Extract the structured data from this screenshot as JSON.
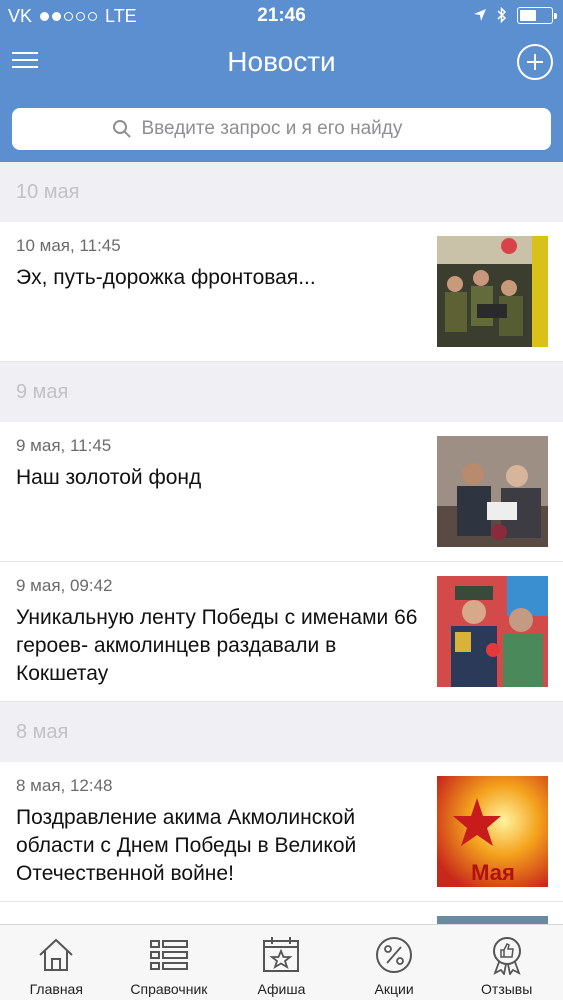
{
  "status_bar": {
    "carrier": "VK",
    "network": "LTE",
    "time": "21:46",
    "signal_bars_filled": 2,
    "signal_bars_total": 5,
    "battery_level": 0.55
  },
  "nav": {
    "title": "Новости",
    "menu_icon": "hamburger-menu-icon",
    "add_icon": "plus-circle-icon"
  },
  "search": {
    "placeholder": "Введите запрос и я его найду",
    "value": ""
  },
  "feed": {
    "date_10": "10 мая",
    "date_9": "9 мая",
    "date_8": "8 мая",
    "items": [
      {
        "time": "10 мая, 11:45",
        "title": "Эх, путь-дорожка фронтовая..."
      },
      {
        "time": "9 мая, 11:45",
        "title": "Наш золотой фонд"
      },
      {
        "time": "9 мая, 09:42",
        "title": "Уникальную ленту Победы с именами 66 героев- акмолинцев раздавали в Кокшетау"
      },
      {
        "time": "8 мая, 12:48",
        "title": "Поздравление акима Акмолинской области с Днем Победы в Великой Отечественной войне!"
      }
    ],
    "thumb4_caption": "Мая"
  },
  "tabs": [
    {
      "label": "Главная",
      "icon": "home-icon"
    },
    {
      "label": "Справочник",
      "icon": "list-icon"
    },
    {
      "label": "Афиша",
      "icon": "calendar-star-icon"
    },
    {
      "label": "Акции",
      "icon": "percent-icon"
    },
    {
      "label": "Отзывы",
      "icon": "thumbs-up-badge-icon"
    }
  ],
  "colors": {
    "header": "#5b8fcf",
    "background": "#efeff4"
  }
}
